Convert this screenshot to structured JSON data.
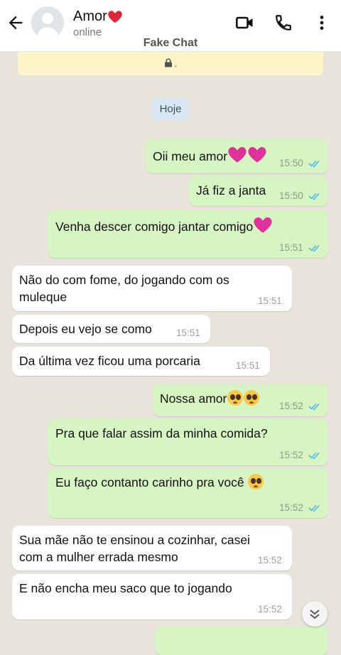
{
  "header": {
    "contact_name": "Amor",
    "contact_status": "online",
    "watermark": "Fake Chat"
  },
  "notice": {
    "text": "."
  },
  "date_divider": "Hoje",
  "messages": [
    {
      "dir": "out",
      "text": "Oii meu amor",
      "time": "15:50",
      "suffix": "2 purple-hearts"
    },
    {
      "dir": "out",
      "text": "Já fiz a janta",
      "time": "15:50"
    },
    {
      "dir": "out",
      "text": "Venha descer comigo jantar comigo",
      "time": "15:51",
      "suffix": "purple-heart"
    },
    {
      "dir": "in",
      "text": "Não do com fome, do jogando com os",
      "text2": "muleque",
      "time": "15:51"
    },
    {
      "dir": "in",
      "text": "Depois eu vejo se como",
      "time": "15:51"
    },
    {
      "dir": "in",
      "text": "Da última vez ficou uma porcaria",
      "time": "15:51"
    },
    {
      "dir": "out",
      "text": "Nossa amor",
      "time": "15:52",
      "suffix": "2 pleading-faces"
    },
    {
      "dir": "out",
      "text": "Pra que falar assim da minha comida?",
      "time": "15:52"
    },
    {
      "dir": "out",
      "text": "Eu faço contanto carinho pra você",
      "time": "15:52",
      "suffix": "pleading-face"
    },
    {
      "dir": "in",
      "text": "Sua mãe não te ensinou a cozinhar, casei",
      "text2": "com a mulher errada mesmo",
      "time": "15:52"
    },
    {
      "dir": "in",
      "text": "E não encha meu saco que to jogando",
      "time": "15:52"
    }
  ],
  "colors": {
    "outgoing_bubble": "#d7f5c2",
    "incoming_bubble": "#ffffff",
    "read_ticks": "#4fb6ec",
    "heart": "#e0309c"
  },
  "icons": [
    "back-arrow-icon",
    "video-call-icon",
    "phone-icon",
    "more-options-icon",
    "lock-icon",
    "double-check-icon",
    "scroll-down-icon"
  ]
}
